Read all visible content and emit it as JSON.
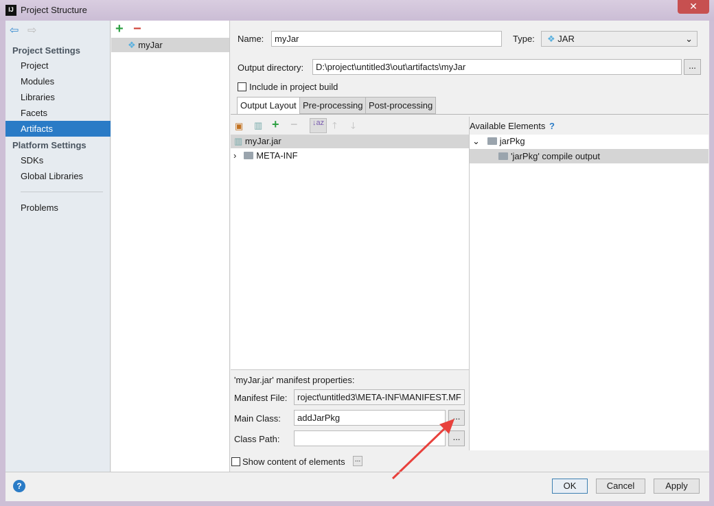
{
  "window": {
    "title": "Project Structure",
    "close": "✕"
  },
  "sidebar": {
    "project_settings": "Project Settings",
    "items": [
      {
        "label": "Project"
      },
      {
        "label": "Modules"
      },
      {
        "label": "Libraries"
      },
      {
        "label": "Facets"
      },
      {
        "label": "Artifacts",
        "selected": true
      }
    ],
    "platform_settings": "Platform Settings",
    "platform_items": [
      {
        "label": "SDKs"
      },
      {
        "label": "Global Libraries"
      }
    ],
    "problems": "Problems"
  },
  "artifacts": {
    "items": [
      {
        "label": "myJar"
      }
    ]
  },
  "form": {
    "name_label": "Name:",
    "name_value": "myJar",
    "type_label": "Type:",
    "type_value": "JAR",
    "output_label": "Output directory:",
    "output_value": "D:\\project\\untitled3\\out\\artifacts\\myJar",
    "browse": "...",
    "include_label": "Include in project build"
  },
  "tabs": [
    {
      "label": "Output Layout"
    },
    {
      "label": "Pre-processing"
    },
    {
      "label": "Post-processing"
    }
  ],
  "layout_tree": [
    {
      "label": "myJar.jar"
    },
    {
      "label": "META-INF"
    }
  ],
  "available": {
    "title": "Available Elements",
    "help": "?",
    "tree": [
      {
        "label": "jarPkg"
      },
      {
        "label": "'jarPkg' compile output"
      }
    ]
  },
  "manifest": {
    "title": "'myJar.jar' manifest properties:",
    "file_label": "Manifest File:",
    "file_value": "roject\\untitled3\\META-INF\\MANIFEST.MF",
    "main_label": "Main Class:",
    "main_value": "addJarPkg",
    "cp_label": "Class Path:",
    "cp_value": "",
    "browse": "..."
  },
  "show_content": "Show content of elements",
  "footer": {
    "ok": "OK",
    "cancel": "Cancel",
    "apply": "Apply",
    "help": "?"
  },
  "colors": {
    "accent": "#2a7bc6",
    "arrow": "#e8413c"
  }
}
